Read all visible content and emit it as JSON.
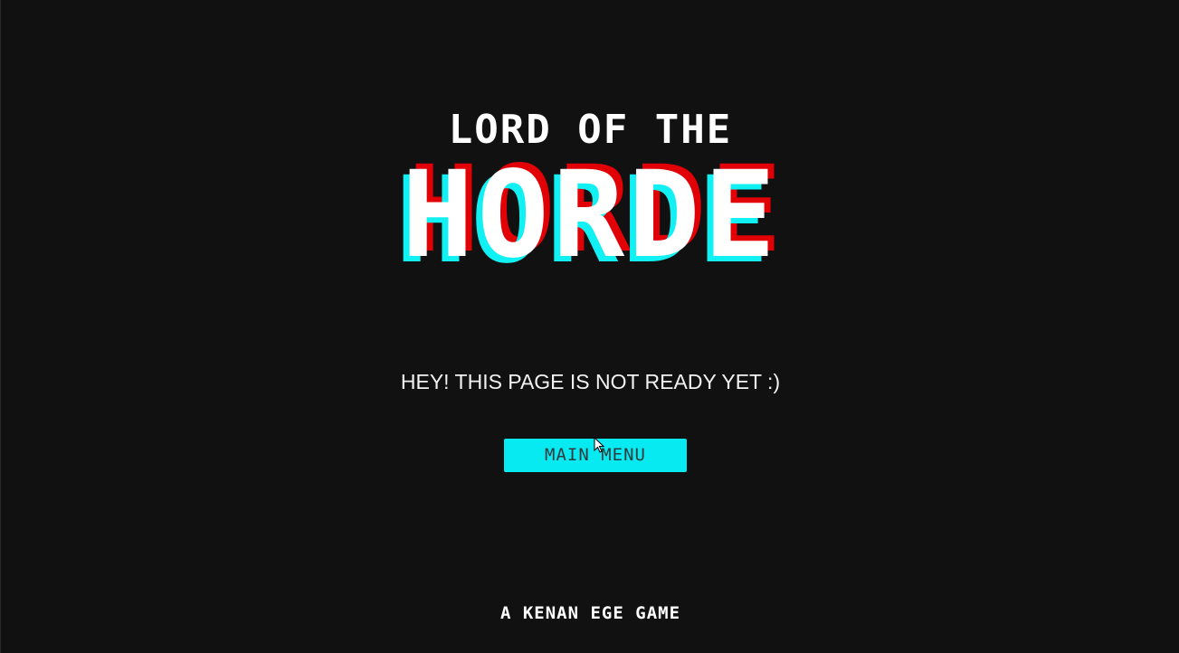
{
  "title": {
    "top_line": "LORD OF THE",
    "main_word": "HORDE"
  },
  "message": "HEY! THIS PAGE IS NOT READY YET :)",
  "buttons": {
    "main_menu": "MAIN MENU"
  },
  "credit": "A KENAN EGE GAME",
  "colors": {
    "background": "#111112",
    "accent_cyan": "#08eaf2",
    "accent_red": "#e00006",
    "text": "#ffffff"
  },
  "icons": {
    "cursor": "mouse-pointer-icon"
  }
}
